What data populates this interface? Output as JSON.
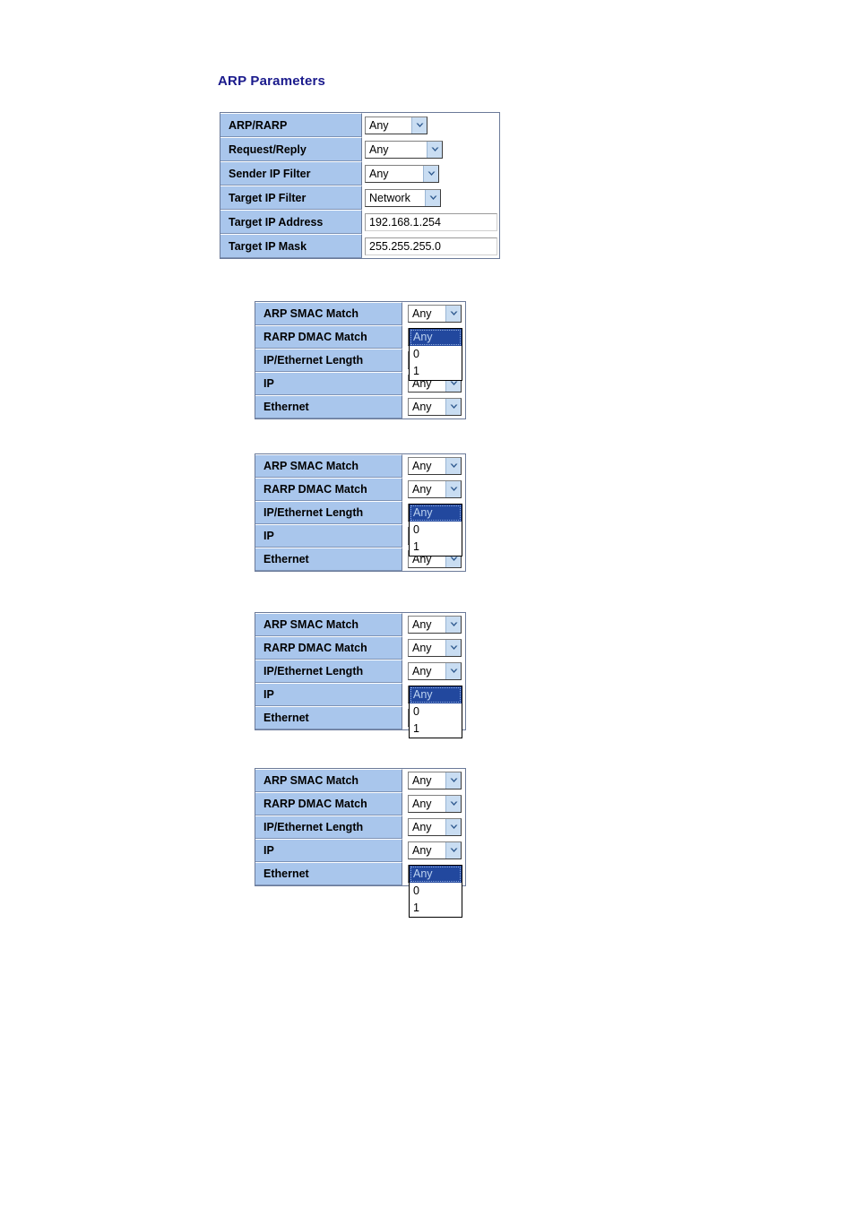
{
  "page": {
    "title": "ARP Parameters",
    "title_color": "#1a1a8c",
    "header_cell_color": "#a9c6ec",
    "highlight_color": "#22489e",
    "highlight_text_color": "#bcd2f0"
  },
  "arp_parameters_table": {
    "rows": [
      {
        "label": "ARP/RARP",
        "control": "select",
        "value": "Any"
      },
      {
        "label": "Request/Reply",
        "control": "select",
        "value": "Any"
      },
      {
        "label": "Sender IP Filter",
        "control": "select",
        "value": "Any"
      },
      {
        "label": "Target IP Filter",
        "control": "select",
        "value": "Network"
      },
      {
        "label": "Target IP Address",
        "control": "text",
        "value": "192.168.1.254"
      },
      {
        "label": "Target IP Mask",
        "control": "text",
        "value": "255.255.255.0"
      }
    ]
  },
  "match_tables": [
    {
      "open_row_index": 1,
      "rows": [
        {
          "label": "ARP SMAC Match",
          "value": "Any"
        },
        {
          "label": "RARP DMAC Match",
          "value": "Any"
        },
        {
          "label": "IP/Ethernet Length",
          "value": "Any"
        },
        {
          "label": "IP",
          "value": "Any"
        },
        {
          "label": "Ethernet",
          "value": "Any"
        }
      ],
      "options": [
        "Any",
        "0",
        "1"
      ],
      "selected_option": "Any"
    },
    {
      "open_row_index": 2,
      "rows": [
        {
          "label": "ARP SMAC Match",
          "value": "Any"
        },
        {
          "label": "RARP DMAC Match",
          "value": "Any"
        },
        {
          "label": "IP/Ethernet Length",
          "value": "Any"
        },
        {
          "label": "IP",
          "value": "Any"
        },
        {
          "label": "Ethernet",
          "value": "Any"
        }
      ],
      "options": [
        "Any",
        "0",
        "1"
      ],
      "selected_option": "Any"
    },
    {
      "open_row_index": 3,
      "rows": [
        {
          "label": "ARP SMAC Match",
          "value": "Any"
        },
        {
          "label": "RARP DMAC Match",
          "value": "Any"
        },
        {
          "label": "IP/Ethernet Length",
          "value": "Any"
        },
        {
          "label": "IP",
          "value": "Any"
        },
        {
          "label": "Ethernet",
          "value": "Any"
        }
      ],
      "options": [
        "Any",
        "0",
        "1"
      ],
      "selected_option": "Any"
    },
    {
      "open_row_index": 4,
      "rows": [
        {
          "label": "ARP SMAC Match",
          "value": "Any"
        },
        {
          "label": "RARP DMAC Match",
          "value": "Any"
        },
        {
          "label": "IP/Ethernet Length",
          "value": "Any"
        },
        {
          "label": "IP",
          "value": "Any"
        },
        {
          "label": "Ethernet",
          "value": "Any"
        }
      ],
      "options": [
        "Any",
        "0",
        "1"
      ],
      "selected_option": "Any"
    }
  ]
}
